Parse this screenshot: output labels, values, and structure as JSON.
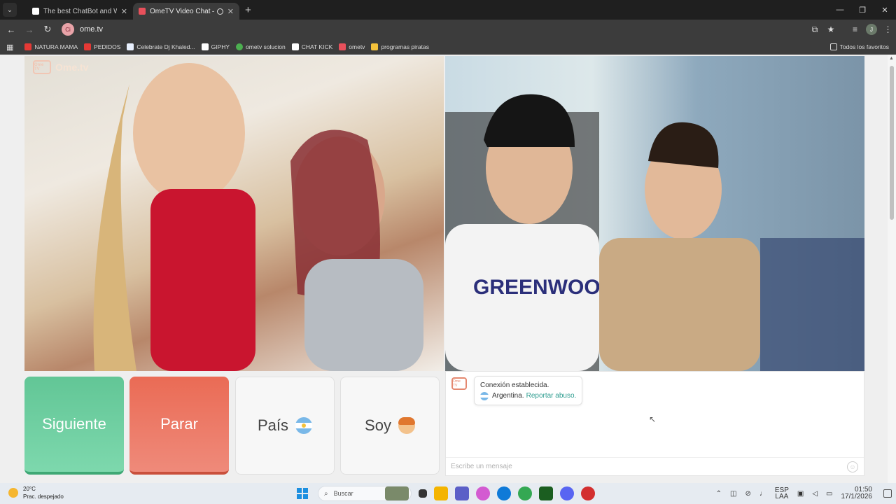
{
  "browser": {
    "tabs": [
      {
        "title": "The best ChatBot and Widgets",
        "favicon_color": "#ffffff",
        "active": false
      },
      {
        "title": "OmeTV Video Chat — Ome",
        "favicon_color": "#e8505b",
        "active": true
      }
    ],
    "url": "ome.tv",
    "site_chip": "Ci",
    "profile_initial": "J",
    "bookmarks": [
      {
        "label": "NATURA MAMA",
        "color": "#e53935"
      },
      {
        "label": "PEDIDOS",
        "color": "#e53935"
      },
      {
        "label": "Celebrate Dj Khaled...",
        "color": "#e8f0fe"
      },
      {
        "label": "GIPHY",
        "color": "#ffffff"
      },
      {
        "label": "ometv solucion",
        "color": "#4caf50"
      },
      {
        "label": "CHAT KICK",
        "color": "#ffffff"
      },
      {
        "label": "ometv",
        "color": "#e8505b"
      },
      {
        "label": "programas piratas",
        "color": "#f4c23b"
      }
    ],
    "bookmarks_all": "Todos los favoritos"
  },
  "ometv": {
    "logo_text": "Ome.tv",
    "logo_icon_text": "Ome TV",
    "buttons": {
      "next": "Siguiente",
      "stop": "Parar",
      "country": "País",
      "gender": "Soy"
    },
    "chat": {
      "status": "Conexión establecida.",
      "country": "Argentina.",
      "report": "Reportar abuso.",
      "input_placeholder": "Escribe un mensaje"
    }
  },
  "taskbar": {
    "weather_temp": "20°C",
    "weather_desc": "Prac. despejado",
    "search_placeholder": "Buscar",
    "lang_line1": "ESP",
    "lang_line2": "LAA",
    "time": "01:50",
    "date": "17/1/2026",
    "app_colors": [
      "#7a8a6a",
      "#333333",
      "#f4b400",
      "#5b5fc7",
      "#d35bd1",
      "#0f7ad8",
      "#34a853",
      "#1b5e20",
      "#5865f2",
      "#d32f2f"
    ]
  }
}
